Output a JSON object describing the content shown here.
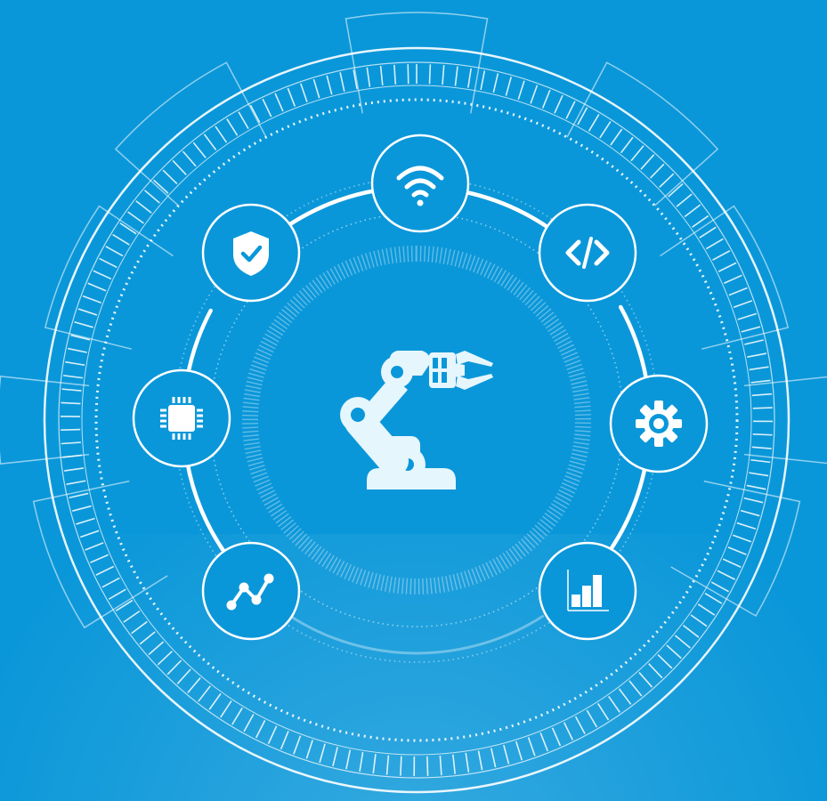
{
  "illustration": {
    "theme": "industrial automation / robotics technology ring",
    "colors": {
      "background": "#0A97D9",
      "line": "#FFFFFF",
      "center_robot": "#E6F6FD",
      "robot_accent": "#0A97D9"
    },
    "center_icon": "robotic-arm-icon",
    "nodes": [
      {
        "icon": "wifi-icon"
      },
      {
        "icon": "code-icon"
      },
      {
        "icon": "gear-icon"
      },
      {
        "icon": "bar-chart-icon"
      },
      {
        "icon": "line-chart-icon"
      },
      {
        "icon": "cpu-chip-icon"
      },
      {
        "icon": "shield-check-icon"
      }
    ]
  }
}
